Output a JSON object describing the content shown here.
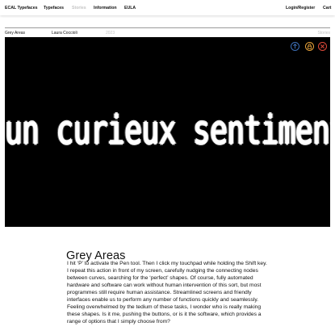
{
  "nav": {
    "brand": "ECAL Typefaces",
    "typefaces": "Typefaces",
    "stories": "Stories",
    "information": "Information",
    "eula": "EULA",
    "login": "Login/Register",
    "cart": "Cart"
  },
  "meta": {
    "title": "Grey Areas",
    "author": "Laura Coccioli",
    "year": "2023",
    "category": "Stories"
  },
  "hero": {
    "text": "un curieux sentiment",
    "buttons": [
      {
        "icon": "arrow-up-icon",
        "color": "#3d6fb6"
      },
      {
        "icon": "lock-icon",
        "color": "#e8a33a"
      },
      {
        "icon": "close-icon",
        "color": "#e04a3a"
      }
    ]
  },
  "article": {
    "title": "Grey Areas",
    "body": "I hit ‘P’ to activate the Pen tool. Then I click my touchpad while holding the Shift key. I repeat this action in front of my screen, carefully nudging the connecting nodes between curves, searching for the ‘perfect’ shapes. Of course, fully automated hardware and software can work without human intervention of this sort, but most programmes still require human assistance. Streamlined screens and friendly interfaces enable us to perform any number of functions quickly and seamlessly. Feeling overwhelmed by the tedium of these tasks, I wonder who is really making these shapes. Is it me, pushing the buttons, or is it the software, which provides a range of options that I simply choose from?"
  }
}
